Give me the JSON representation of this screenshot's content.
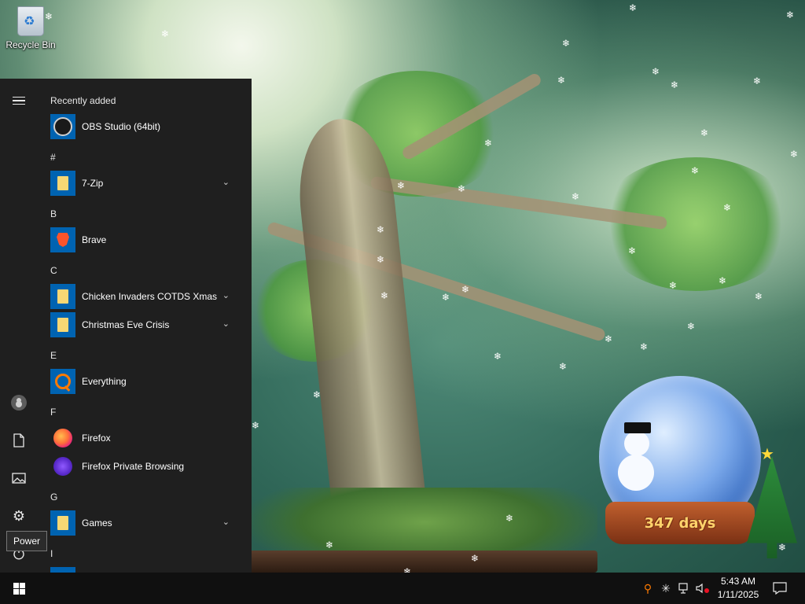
{
  "desktop": {
    "recycle_bin_label": "Recycle Bin",
    "snow_glyph": "❄"
  },
  "start_menu": {
    "tooltip": "Power",
    "sections": [
      {
        "header": "Recently added",
        "items": [
          {
            "name": "OBS Studio (64bit)",
            "icon": "obs-icon",
            "expandable": false
          }
        ]
      },
      {
        "header": "#",
        "items": [
          {
            "name": "7-Zip",
            "icon": "folder-icon",
            "expandable": true
          }
        ]
      },
      {
        "header": "B",
        "items": [
          {
            "name": "Brave",
            "icon": "brave-icon",
            "expandable": false
          }
        ]
      },
      {
        "header": "C",
        "items": [
          {
            "name": "Chicken Invaders COTDS Xmas",
            "icon": "folder-icon",
            "expandable": true
          },
          {
            "name": "Christmas Eve Crisis",
            "icon": "folder-icon",
            "expandable": true
          }
        ]
      },
      {
        "header": "E",
        "items": [
          {
            "name": "Everything",
            "icon": "everything-icon",
            "expandable": false
          }
        ]
      },
      {
        "header": "F",
        "items": [
          {
            "name": "Firefox",
            "icon": "firefox-icon",
            "expandable": false
          },
          {
            "name": "Firefox Private Browsing",
            "icon": "firefox-private-icon",
            "expandable": false
          }
        ]
      },
      {
        "header": "G",
        "items": [
          {
            "name": "Games",
            "icon": "folder-icon",
            "expandable": true
          }
        ]
      },
      {
        "header": "I",
        "items": []
      }
    ]
  },
  "widget": {
    "days_label": "347 days"
  },
  "taskbar": {
    "time": "5:43 AM",
    "date": "1/11/2025"
  },
  "colors": {
    "start_menu_bg": "#1f1f1f",
    "tile_blue": "#0063b1",
    "taskbar_bg": "#101010"
  }
}
